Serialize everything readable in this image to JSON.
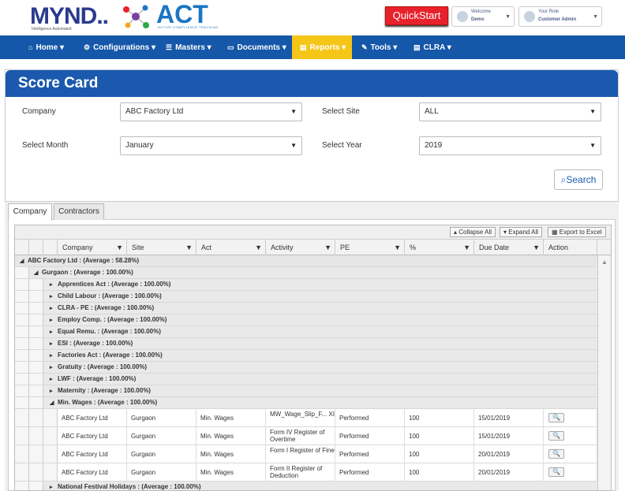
{
  "brand": {
    "mynd": "MYND..",
    "mynd_sub": "Intelligence Automated",
    "act": "ACT",
    "act_sub": "ACTIVE COMPLIANCE TRACKING"
  },
  "header": {
    "quickstart": "QuickStart",
    "welcome_label": "Welcome",
    "welcome_user": "Demo",
    "role_label": "Your Role",
    "role_value": "Customer Admin"
  },
  "nav": [
    {
      "label": "Home",
      "icon": "home-icon",
      "glyph": "⌂"
    },
    {
      "label": "Configurations",
      "icon": "gear-icon",
      "glyph": "⚙"
    },
    {
      "label": "Masters",
      "icon": "server-icon",
      "glyph": "☰"
    },
    {
      "label": "Documents",
      "icon": "folder-icon",
      "glyph": "▭"
    },
    {
      "label": "Reports",
      "icon": "file-icon",
      "glyph": "▤"
    },
    {
      "label": "Tools",
      "icon": "wrench-icon",
      "glyph": "✎"
    },
    {
      "label": "CLRA",
      "icon": "file-icon",
      "glyph": "▤"
    }
  ],
  "page": {
    "title": "Score Card"
  },
  "filters": {
    "company_label": "Company",
    "company_value": "ABC Factory Ltd",
    "site_label": "Select Site",
    "site_value": "ALL",
    "month_label": "Select Month",
    "month_value": "January",
    "year_label": "Select Year",
    "year_value": "2019",
    "search_label": "Search"
  },
  "tabs": [
    "Company",
    "Contractors"
  ],
  "toolbar": {
    "collapse": "Collapse All",
    "expand": "Expand All",
    "export": "Export to Excel"
  },
  "columns": [
    "Company",
    "Site",
    "Act",
    "Activity",
    "PE",
    "%",
    "Due Date",
    "Action"
  ],
  "groups": {
    "company": "ABC Factory Ltd : (Average : 58.28%)",
    "site": "Gurgaon : (Average : 100.00%)",
    "acts": [
      "Apprentices Act : (Average : 100.00%)",
      "Child Labour : (Average : 100.00%)",
      "CLRA - PE : (Average : 100.00%)",
      "Employ Comp. : (Average : 100.00%)",
      "Equal Remu. : (Average : 100.00%)",
      "ESI : (Average : 100.00%)",
      "Factories Act : (Average : 100.00%)",
      "Gratuity : (Average : 100.00%)",
      "LWF : (Average : 100.00%)",
      "Maternity : (Average : 100.00%)",
      "Min. Wages : (Average : 100.00%)"
    ],
    "after": "National Festival Holidays : (Average : 100.00%)"
  },
  "rows": [
    {
      "company": "ABC Factory Ltd",
      "site": "Gurgaon",
      "act": "Min. Wages",
      "activity": "MW_Wage_Slip_F... XI",
      "pe": "Performed",
      "pct": "100",
      "due": "15/01/2019"
    },
    {
      "company": "ABC Factory Ltd",
      "site": "Gurgaon",
      "act": "Min. Wages",
      "activity": "Form IV Register of Overtime",
      "pe": "Performed",
      "pct": "100",
      "due": "15/01/2019"
    },
    {
      "company": "ABC Factory Ltd",
      "site": "Gurgaon",
      "act": "Min. Wages",
      "activity": "Form I Register of Fine",
      "pe": "Performed",
      "pct": "100",
      "due": "20/01/2019"
    },
    {
      "company": "ABC Factory Ltd",
      "site": "Gurgaon",
      "act": "Min. Wages",
      "activity": "Form II Register of Deduction",
      "pe": "Performed",
      "pct": "100",
      "due": "20/01/2019"
    }
  ],
  "colors": {
    "nav": "#1557a8",
    "active_nav": "#f5c518",
    "panel_head": "#1a59ad",
    "quickstart": "#e8222b"
  }
}
